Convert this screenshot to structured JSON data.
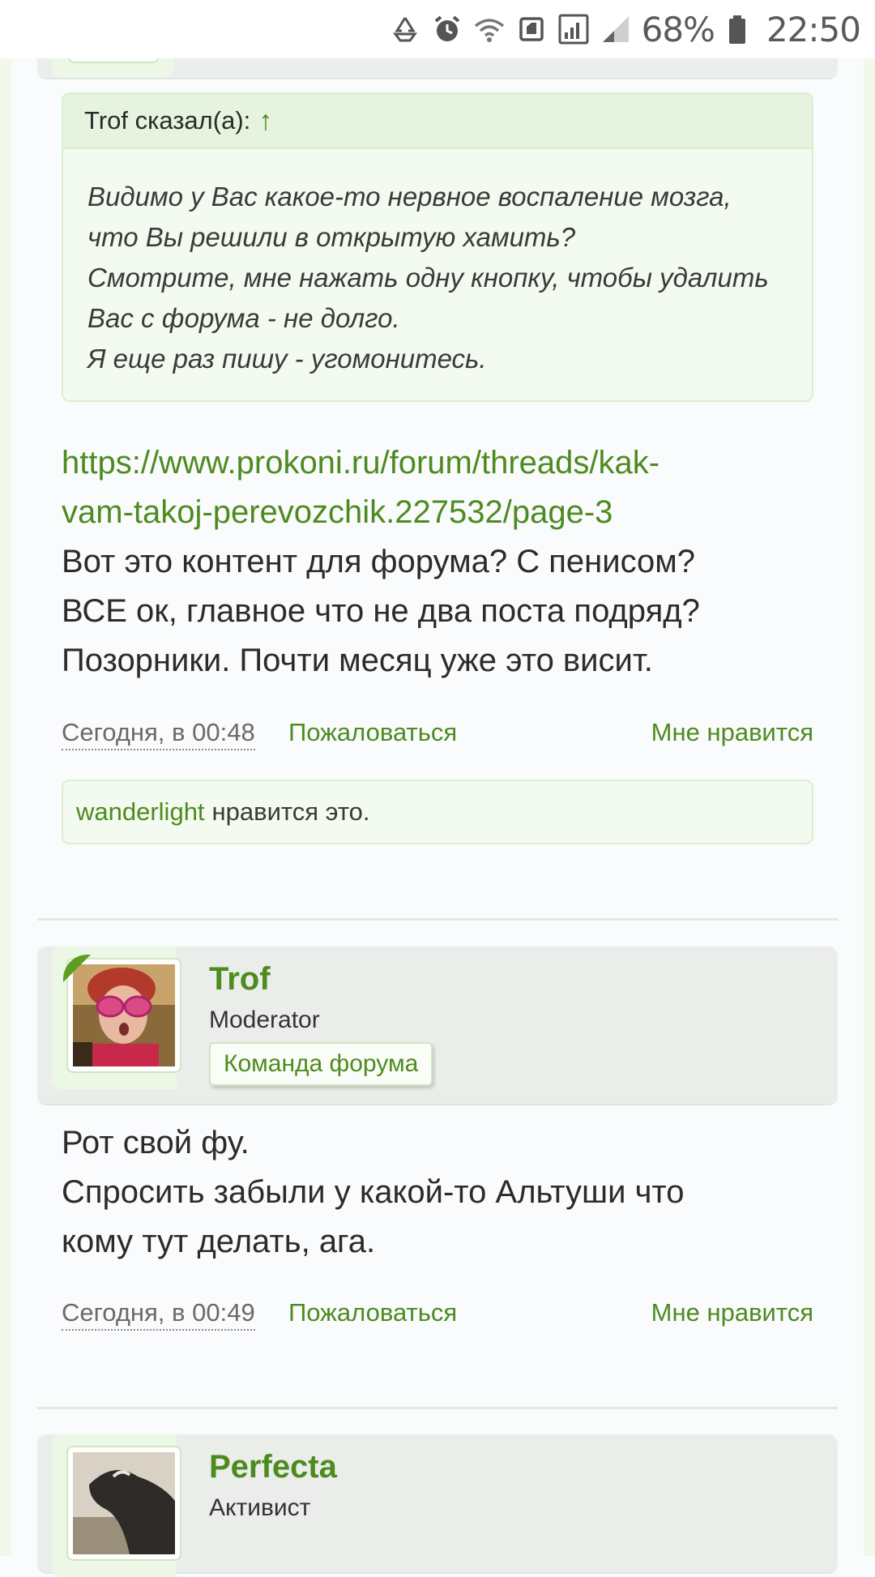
{
  "status_bar": {
    "battery_percent": "68%",
    "time": "22:50",
    "icons": [
      "recycle-icon",
      "alarm-icon",
      "wifi-icon",
      "nfc-icon",
      "signal-icon",
      "signal-weak-icon",
      "battery-icon"
    ]
  },
  "quote": {
    "author_label": "Trof сказал(а):",
    "arrow": "↑",
    "lines": [
      "Видимо у Вас какое-то нервное воспаление мозга,",
      "что Вы решили в открытую хамить?",
      "Смотрите, мне нажать одну кнопку, чтобы удалить",
      "Вас с форума - не долго.",
      "Я еще раз пишу - угомонитесь."
    ]
  },
  "post1": {
    "link_lines": [
      "https://www.prokoni.ru/forum/threads/kak-",
      "vam-takoj-perevozchik.227532/page-3"
    ],
    "text_lines": [
      "Вот это контент для форума? С пенисом?",
      "ВСЕ ок, главное что не два поста подряд?",
      "Позорники. Почти месяц уже это висит."
    ],
    "date": "Сегодня, в 00:48",
    "report": "Пожаловаться",
    "like": "Мне нравится",
    "likes_user": "wanderlight",
    "likes_text": "нравится это."
  },
  "post2": {
    "username": "Trof",
    "user_title": "Moderator",
    "badge": "Команда форума",
    "text_lines": [
      "Рот свой фу.",
      "Спросить забыли у какой-то Альтуши что",
      "кому тут делать, ага."
    ],
    "date": "Сегодня, в 00:49",
    "report": "Пожаловаться",
    "like": "Мне нравится"
  },
  "post3": {
    "username": "Perfecta",
    "user_title": "Активист"
  },
  "colors": {
    "accent": "#4d8b1f",
    "quote_bg": "#f3faef",
    "header_bg": "#ebedeb"
  }
}
